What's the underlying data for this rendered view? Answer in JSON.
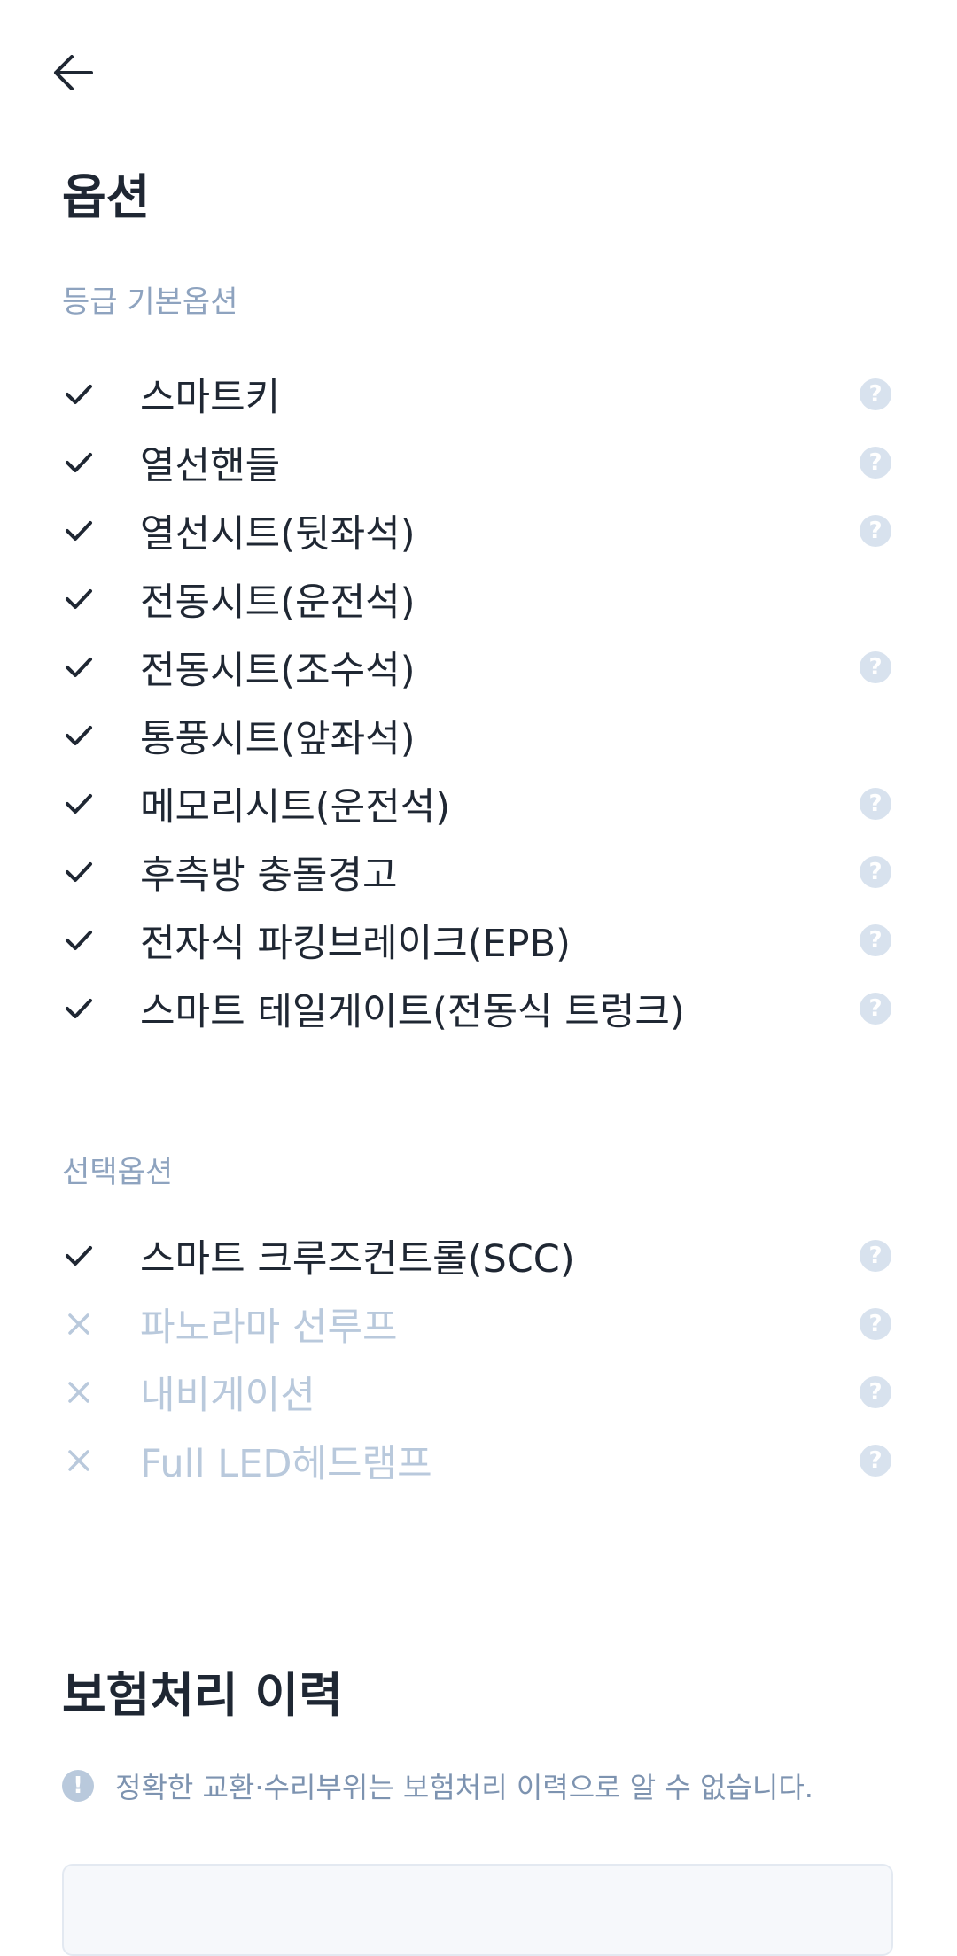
{
  "header": {
    "back_icon": "arrow-left-icon",
    "title": "옵션"
  },
  "basic_options": {
    "label": "등급 기본옵션",
    "items": [
      {
        "label": "스마트키",
        "included": true,
        "help": true
      },
      {
        "label": "열선핸들",
        "included": true,
        "help": true
      },
      {
        "label": "열선시트(뒷좌석)",
        "included": true,
        "help": true
      },
      {
        "label": "전동시트(운전석)",
        "included": true,
        "help": false
      },
      {
        "label": "전동시트(조수석)",
        "included": true,
        "help": true
      },
      {
        "label": "통풍시트(앞좌석)",
        "included": true,
        "help": false
      },
      {
        "label": "메모리시트(운전석)",
        "included": true,
        "help": true
      },
      {
        "label": "후측방 충돌경고",
        "included": true,
        "help": true
      },
      {
        "label": "전자식 파킹브레이크(EPB)",
        "included": true,
        "help": true
      },
      {
        "label": "스마트 테일게이트(전동식 트렁크)",
        "included": true,
        "help": true
      }
    ]
  },
  "selected_options": {
    "label": "선택옵션",
    "items": [
      {
        "label": "스마트 크루즈컨트롤(SCC)",
        "included": true,
        "help": true
      },
      {
        "label": "파노라마 선루프",
        "included": false,
        "help": true
      },
      {
        "label": "내비게이션",
        "included": false,
        "help": true
      },
      {
        "label": "Full LED헤드램프",
        "included": false,
        "help": true
      }
    ]
  },
  "insurance": {
    "title": "보험처리 이력",
    "notice_icon": "exclamation-icon",
    "notice": "정확한 교환·수리부위는 보험처리 이력으로 알 수 없습니다."
  },
  "colors": {
    "check": "#1f2733",
    "cross": "#b9c9dc",
    "help": "#d8e2ee",
    "section_label": "#8ea3bf"
  }
}
